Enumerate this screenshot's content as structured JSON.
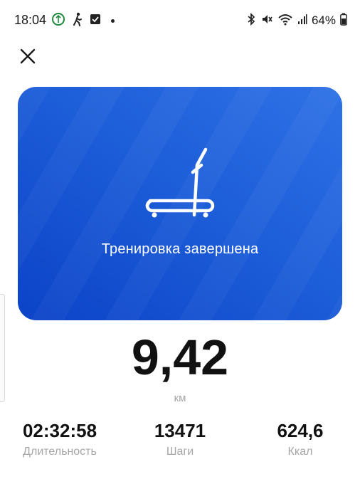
{
  "status_bar": {
    "time": "18:04",
    "battery": "64%",
    "icons_left": [
      "ring-app-icon",
      "walking-icon",
      "checkbox-icon",
      "dot-icon"
    ],
    "icons_right": [
      "bluetooth-icon",
      "vibrate-mute-icon",
      "wifi-icon",
      "signal-icon",
      "battery-icon"
    ]
  },
  "header": {
    "close_icon": "close-icon"
  },
  "hero": {
    "icon": "treadmill-icon",
    "title": "Тренировка завершена",
    "colors": {
      "gradient_start": "#2f72e6",
      "gradient_end": "#0c43c7"
    }
  },
  "distance": {
    "value": "9,42",
    "unit": "км"
  },
  "stats": [
    {
      "value": "02:32:58",
      "label": "Длительность"
    },
    {
      "value": "13471",
      "label": "Шаги"
    },
    {
      "value": "624,6",
      "label": "Ккал"
    }
  ]
}
